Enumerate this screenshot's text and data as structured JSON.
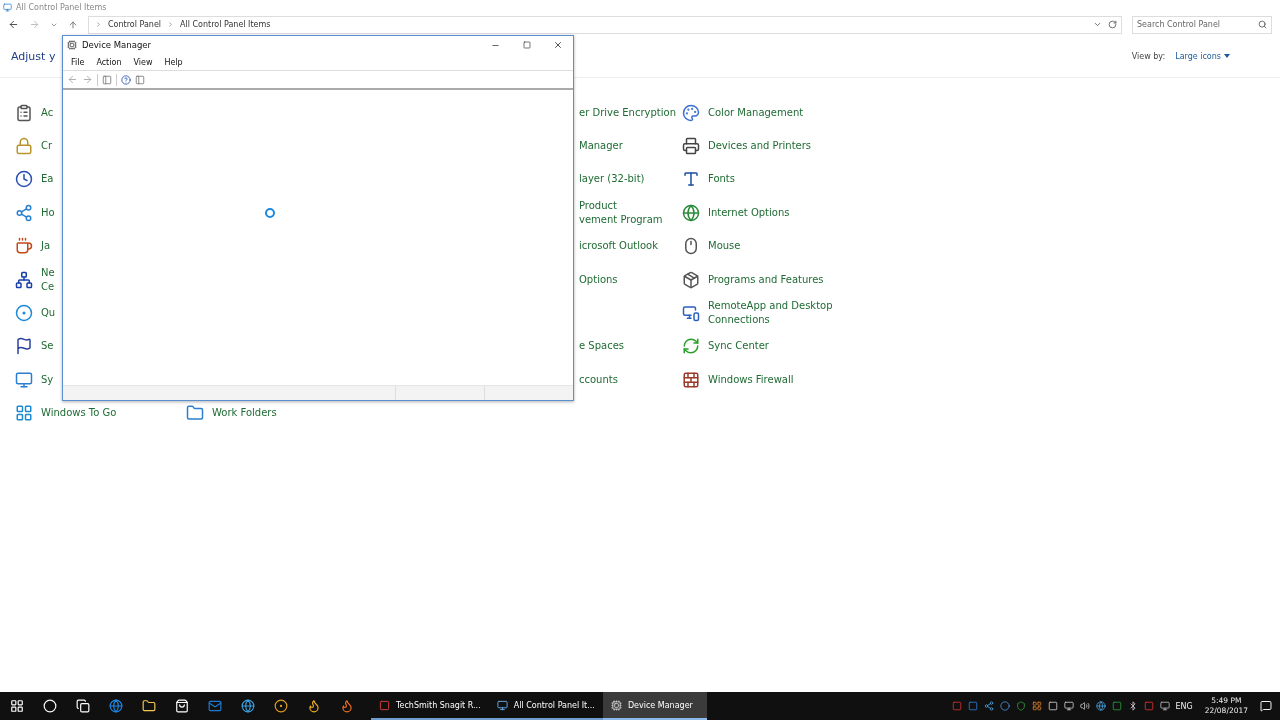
{
  "control_panel": {
    "title": "All Control Panel Items",
    "breadcrumb": [
      "Control Panel",
      "All Control Panel Items"
    ],
    "search": {
      "placeholder": "Search Control Panel"
    },
    "heading": "Adjust y",
    "view_by": {
      "label": "View by:",
      "value": "Large icons"
    },
    "columns": [
      [
        {
          "kind": "stub",
          "lines": [
            "Ac"
          ]
        },
        {
          "kind": "stub",
          "lines": [
            "Cr"
          ]
        },
        {
          "kind": "stub",
          "lines": [
            "Ea"
          ]
        },
        {
          "kind": "stub",
          "lines": [
            "Ho"
          ]
        },
        {
          "kind": "stub",
          "lines": [
            "Ja"
          ]
        },
        {
          "kind": "stub",
          "lines": [
            "Ne",
            "Ce"
          ]
        },
        {
          "kind": "stub",
          "lines": [
            "Qu"
          ]
        },
        {
          "kind": "stub",
          "lines": [
            "Se"
          ]
        },
        {
          "kind": "stub",
          "lines": [
            "Sy"
          ]
        },
        {
          "kind": "full",
          "lines": [
            "Windows To Go"
          ]
        }
      ],
      [
        {
          "kind": "tail",
          "lines": [
            "er Drive Encryption"
          ]
        },
        {
          "kind": "tail",
          "lines": [
            "Manager"
          ]
        },
        {
          "kind": "tail",
          "lines": [
            "layer (32-bit)"
          ]
        },
        {
          "kind": "tail",
          "lines": [
            "Product",
            "vement Program"
          ]
        },
        {
          "kind": "tail",
          "lines": [
            "icrosoft Outlook"
          ]
        },
        {
          "kind": "tail",
          "lines": [
            "Options"
          ]
        },
        {
          "kind": "blank"
        },
        {
          "kind": "tail",
          "lines": [
            "e Spaces"
          ]
        },
        {
          "kind": "tail",
          "lines": [
            "ccounts"
          ]
        },
        {
          "kind": "full",
          "lines": [
            "Work Folders"
          ]
        }
      ],
      [
        {
          "kind": "full",
          "lines": [
            "Color Management"
          ]
        },
        {
          "kind": "full",
          "lines": [
            "Devices and Printers"
          ]
        },
        {
          "kind": "full",
          "lines": [
            "Fonts"
          ]
        },
        {
          "kind": "full",
          "lines": [
            "Internet Options"
          ]
        },
        {
          "kind": "full",
          "lines": [
            "Mouse"
          ]
        },
        {
          "kind": "full",
          "lines": [
            "Programs and Features"
          ]
        },
        {
          "kind": "full",
          "lines": [
            "RemoteApp and Desktop",
            "Connections"
          ]
        },
        {
          "kind": "full",
          "lines": [
            "Sync Center"
          ]
        },
        {
          "kind": "full",
          "lines": [
            "Windows Firewall"
          ]
        }
      ]
    ]
  },
  "device_manager": {
    "title": "Device Manager",
    "menu": [
      "File",
      "Action",
      "View",
      "Help"
    ],
    "loading": true
  },
  "taskbar": {
    "tasks": [
      {
        "label": "TechSmith Snagit R...",
        "selected": false
      },
      {
        "label": "All Control Panel It...",
        "selected": false
      },
      {
        "label": "Device Manager",
        "selected": true
      }
    ],
    "language": "ENG",
    "time": "5:49 PM",
    "date": "22/08/2017"
  }
}
